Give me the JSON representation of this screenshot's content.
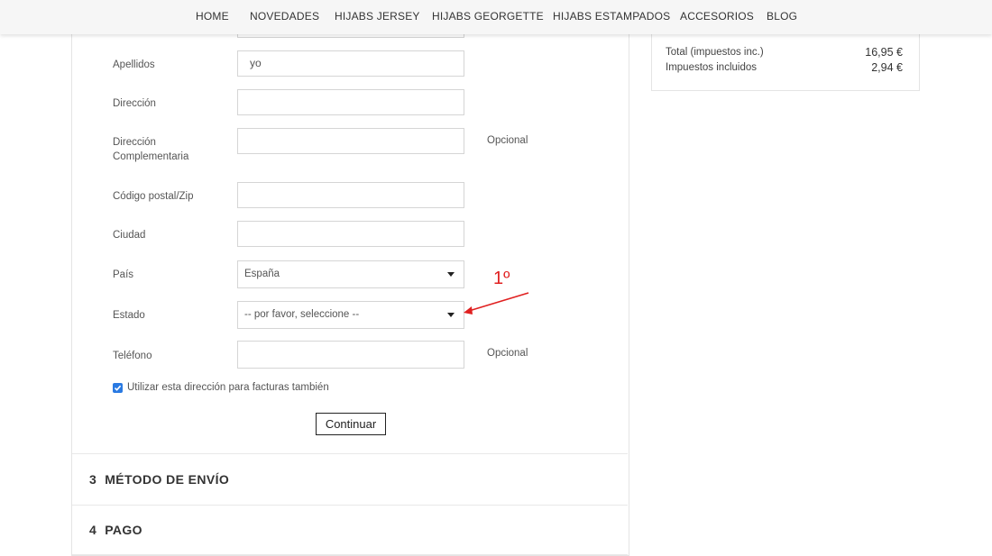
{
  "nav": {
    "items": [
      "HOME",
      "NOVEDADES",
      "HIJABS JERSEY",
      "HIJABS GEORGETTE",
      "HIJABS ESTAMPADOS",
      "ACCESORIOS",
      "BLOG"
    ]
  },
  "form": {
    "apellidos": {
      "label": "Apellidos",
      "value": "yo"
    },
    "direccion": {
      "label": "Dirección",
      "value": ""
    },
    "direccion2": {
      "label": "Dirección Complementaria",
      "value": "",
      "optional": "Opcional"
    },
    "postal": {
      "label": "Código postal/Zip",
      "value": ""
    },
    "ciudad": {
      "label": "Ciudad",
      "value": ""
    },
    "pais": {
      "label": "País",
      "value": "España"
    },
    "estado": {
      "label": "Estado",
      "value": "-- por favor, seleccione --"
    },
    "telefono": {
      "label": "Teléfono",
      "value": "",
      "optional": "Opcional"
    },
    "checkbox": {
      "label": "Utilizar esta dirección para facturas también",
      "checked": true
    },
    "continue_label": "Continuar"
  },
  "steps": [
    {
      "num": "3",
      "title": "MÉTODO DE ENVÍO"
    },
    {
      "num": "4",
      "title": "PAGO"
    }
  ],
  "summary": {
    "total_label": "Total (impuestos inc.)",
    "total_value": "16,95 €",
    "tax_label": "Impuestos incluidos",
    "tax_value": "2,94 €"
  },
  "annotation": {
    "text": "1º",
    "color": "#e02020"
  }
}
